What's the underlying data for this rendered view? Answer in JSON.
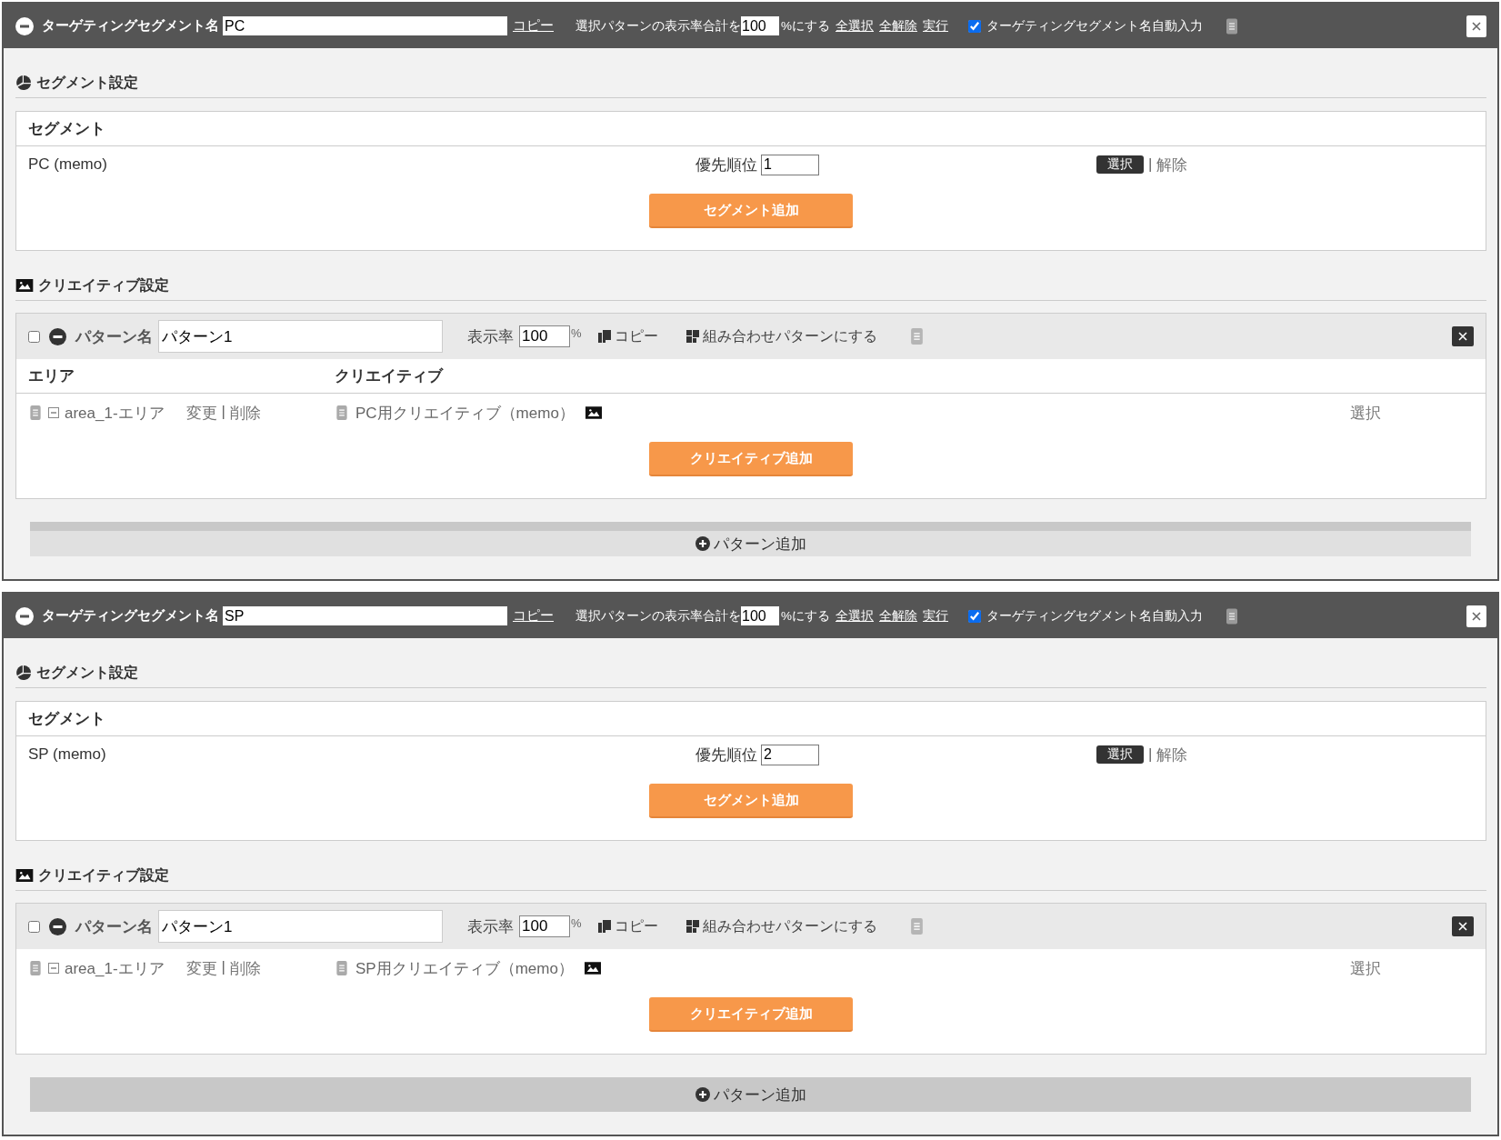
{
  "panels": [
    {
      "header": {
        "name_label": "ターゲティングセグメント名",
        "name_value": "PC",
        "copy_link": "コピー",
        "total_label": "選択パターンの表示率合計を",
        "total_value": "100",
        "total_suffix": "%にする",
        "links": [
          "全選択",
          "全解除",
          "実行"
        ],
        "auto_input": {
          "label": "ターゲティングセグメント名自動入力",
          "checked": true
        }
      },
      "segment_settings": {
        "title": "セグメント設定",
        "table": {
          "heading": "セグメント",
          "rows": [
            {
              "name": "PC (memo)",
              "priority_label": "優先順位",
              "priority_value": "1",
              "select_button": "選択",
              "separator": "|",
              "release_link": "解除"
            }
          ]
        },
        "add_button": "セグメント追加"
      },
      "creative_settings": {
        "title": "クリエイティブ設定",
        "patterns": [
          {
            "checked": false,
            "name_label": "パターン名",
            "name_value": "パターン1",
            "rate_label": "表示率",
            "rate_value": "100",
            "rate_unit": "%",
            "copy_button": "コピー",
            "combine_button": "組み合わせパターンにする",
            "columns": [
              "エリア",
              "クリエイティブ"
            ],
            "rows": [
              {
                "area": "area_1-エリア",
                "change_link": "変更",
                "separator": "|",
                "delete_link": "削除",
                "creative": "PC用クリエイティブ（memo）",
                "select_link": "選択"
              }
            ],
            "add_button": "クリエイティブ追加"
          }
        ]
      },
      "add_pattern": {
        "label": "パターン追加",
        "highlighted": true
      }
    },
    {
      "header": {
        "name_label": "ターゲティングセグメント名",
        "name_value": "SP",
        "copy_link": "コピー",
        "total_label": "選択パターンの表示率合計を",
        "total_value": "100",
        "total_suffix": "%にする",
        "links": [
          "全選択",
          "全解除",
          "実行"
        ],
        "auto_input": {
          "label": "ターゲティングセグメント名自動入力",
          "checked": true
        }
      },
      "segment_settings": {
        "title": "セグメント設定",
        "table": {
          "heading": "セグメント",
          "rows": [
            {
              "name": "SP (memo)",
              "priority_label": "優先順位",
              "priority_value": "2",
              "select_button": "選択",
              "separator": "|",
              "release_link": "解除"
            }
          ]
        },
        "add_button": "セグメント追加"
      },
      "creative_settings": {
        "title": "クリエイティブ設定",
        "patterns": [
          {
            "checked": false,
            "name_label": "パターン名",
            "name_value": "パターン1",
            "rate_label": "表示率",
            "rate_value": "100",
            "rate_unit": "%",
            "copy_button": "コピー",
            "combine_button": "組み合わせパターンにする",
            "rows": [
              {
                "area": "area_1-エリア",
                "change_link": "変更",
                "separator": "|",
                "delete_link": "削除",
                "creative": "SP用クリエイティブ（memo）",
                "select_link": "選択"
              }
            ],
            "add_button": "クリエイティブ追加"
          }
        ]
      },
      "add_pattern": {
        "label": "パターン追加",
        "highlighted": false
      }
    }
  ]
}
